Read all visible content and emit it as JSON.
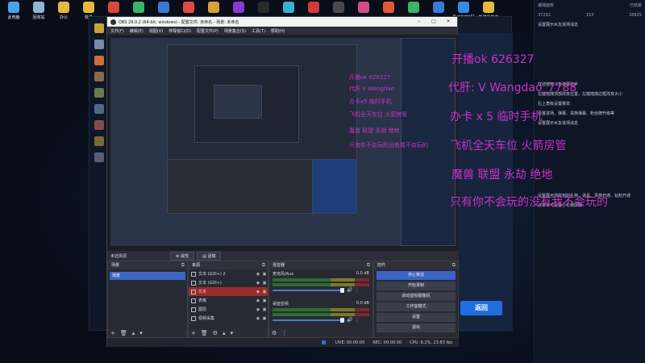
{
  "desktop": {
    "icons": [
      {
        "label": "此电脑",
        "color": "#4aa3e8"
      },
      {
        "label": "回收站",
        "color": "#8fb6d4"
      },
      {
        "label": "办公",
        "color": "#e6b83c"
      },
      {
        "label": "软件",
        "color": "#e6b83c"
      },
      {
        "label": "",
        "color": "#d44a3a"
      },
      {
        "label": "",
        "color": "#3ab46a"
      },
      {
        "label": "",
        "color": "#3a7ad4"
      },
      {
        "label": "",
        "color": "#e04a4a"
      },
      {
        "label": "",
        "color": "#d4a13a"
      },
      {
        "label": "",
        "color": "#8a3ad4"
      },
      {
        "label": "",
        "color": "#2a2a2a"
      },
      {
        "label": "",
        "color": "#3ab0d4"
      },
      {
        "label": "",
        "color": "#d43a3a"
      },
      {
        "label": "",
        "color": "#4a4a4a"
      },
      {
        "label": "",
        "color": "#d44a8a"
      },
      {
        "label": "",
        "color": "#e05a3a"
      },
      {
        "label": "",
        "color": "#3ab46a"
      },
      {
        "label": "",
        "color": "#3a7ad4"
      },
      {
        "label": "SunloginCl...",
        "color": "#3a8ae0"
      },
      {
        "label": "新建文件夹",
        "color": "#e6b83c"
      }
    ]
  },
  "right_app": {
    "stat_a": "编播面板",
    "stat_b": "已结束",
    "count_a": "37292",
    "count_b": "153",
    "count_c": "28825",
    "notes": [
      "设置展示水友进场消息",
      "欢迎使用斗鱼弹幕助手",
      "左键拖拽顶部改变位置，左键拖拽边框改变大小",
      "右上角有设置菜单",
      "设置进场、弹幕、贵族弹幕、粉丝牌升级等",
      "设置展示水友进场消息",
      "设置展示你收到的礼物、道具、贵族开通、钻粉开通",
      "点菜单可设置小礼物屏蔽"
    ]
  },
  "game": {
    "button_label": "返回"
  },
  "obs": {
    "title": "OBS 28.0.2 (64-bit, windows) - 配置文件: 未命名 - 场景: 未命名",
    "menu": [
      "文件(F)",
      "编辑(E)",
      "视图(V)",
      "停靠窗口(D)",
      "配置文件(P)",
      "场景集合(S)",
      "工具(T)",
      "帮助(H)"
    ],
    "source_bar": {
      "label": "未选择源",
      "properties": "属性",
      "filters": "滤镜"
    },
    "scenes": {
      "title": "场景",
      "items": [
        "场景"
      ]
    },
    "sources": {
      "title": "来源",
      "items": [
        {
          "name": "文本 (GDI+) 2",
          "selected": false
        },
        {
          "name": "文本 (GDI+)",
          "selected": false
        },
        {
          "name": "文本",
          "selected": true
        },
        {
          "name": "表格",
          "selected": false
        },
        {
          "name": "图层",
          "selected": false
        },
        {
          "name": "视频采集",
          "selected": false
        }
      ]
    },
    "mixer": {
      "title": "混音器",
      "channels": [
        {
          "name": "麦克风/Aux",
          "db": "0.0 dB"
        },
        {
          "name": "桌面音频",
          "db": "0.0 dB"
        }
      ]
    },
    "controls": {
      "title": "控件",
      "buttons": [
        "停止推流",
        "开始录制",
        "启动虚拟摄像机",
        "工作室模式",
        "设置",
        "退出"
      ]
    },
    "status": {
      "live": "LIVE: 00:00:00",
      "rec": "REC: 00:00:00",
      "cpu": "CPU: 6.2%, 23.83 fps"
    }
  },
  "danmaku": [
    "开播ok     626327",
    "代肝: V Wangdao_7788",
    "办卡 x 5    临时手机",
    "飞机全天车位 火箭房管",
    "魔兽  联盟  永劫  绝地",
    "只有你不会玩的没有我不会玩的"
  ],
  "danmaku_small": [
    "开播ok  626327",
    "代肝 V Wangdao",
    "办卡x5 临时手机",
    "飞机全天车位 火箭房管",
    "魔兽  联盟  永劫  绝地",
    "只有你不会玩的没有我不会玩的"
  ]
}
